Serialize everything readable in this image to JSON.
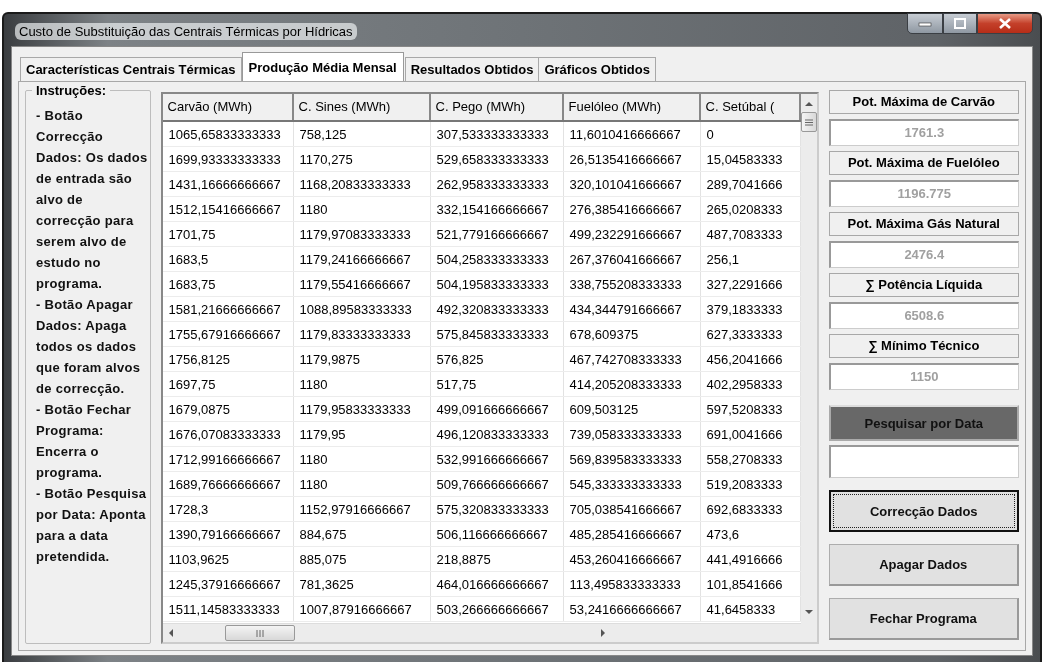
{
  "window": {
    "title": "Custo de Substituição das Centrais Térmicas por Hídricas"
  },
  "tabs": [
    {
      "label": "Características Centrais Térmicas",
      "selected": false
    },
    {
      "label": "Produção Média Mensal",
      "selected": true
    },
    {
      "label": "Resultados Obtidos",
      "selected": false
    },
    {
      "label": "Gráficos Obtidos",
      "selected": false
    }
  ],
  "instructions": {
    "title": "Instruções:",
    "items": [
      "- Botão Correcção Dados: Os dados de entrada são alvo de correcção para serem alvo de estudo no programa.",
      "- Botão Apagar Dados: Apaga todos os dados que foram alvos de correcção.",
      "- Botão Fechar Programa: Encerra o programa.",
      "- Botão Pesquisa por Data: Aponta para a data pretendida."
    ]
  },
  "table": {
    "columns": [
      "Carvão (MWh)",
      "C. Sines (MWh)",
      "C. Pego (MWh)",
      "Fuelóleo (MWh)",
      "C. Setúbal ("
    ],
    "rows": [
      [
        "1065,65833333333",
        "758,125",
        "307,533333333333",
        "11,6010416666667",
        "0"
      ],
      [
        "1699,93333333333",
        "1170,275",
        "529,658333333333",
        "26,5135416666667",
        "15,04583333"
      ],
      [
        "1431,16666666667",
        "1168,20833333333",
        "262,958333333333",
        "320,101041666667",
        "289,7041666"
      ],
      [
        "1512,15416666667",
        "1180",
        "332,154166666667",
        "276,385416666667",
        "265,0208333"
      ],
      [
        "1701,75",
        "1179,97083333333",
        "521,779166666667",
        "499,232291666667",
        "487,7083333"
      ],
      [
        "1683,5",
        "1179,24166666667",
        "504,258333333333",
        "267,376041666667",
        "256,1"
      ],
      [
        "1683,75",
        "1179,55416666667",
        "504,195833333333",
        "338,755208333333",
        "327,2291666"
      ],
      [
        "1581,21666666667",
        "1088,89583333333",
        "492,320833333333",
        "434,344791666667",
        "379,1833333"
      ],
      [
        "1755,67916666667",
        "1179,83333333333",
        "575,845833333333",
        "678,609375",
        "627,3333333"
      ],
      [
        "1756,8125",
        "1179,9875",
        "576,825",
        "467,742708333333",
        "456,2041666"
      ],
      [
        "1697,75",
        "1180",
        "517,75",
        "414,205208333333",
        "402,2958333"
      ],
      [
        "1679,0875",
        "1179,95833333333",
        "499,091666666667",
        "609,503125",
        "597,5208333"
      ],
      [
        "1676,07083333333",
        "1179,95",
        "496,120833333333",
        "739,058333333333",
        "691,0041666"
      ],
      [
        "1712,99166666667",
        "1180",
        "532,991666666667",
        "569,839583333333",
        "558,2708333"
      ],
      [
        "1689,76666666667",
        "1180",
        "509,766666666667",
        "545,333333333333",
        "519,2083333"
      ],
      [
        "1728,3",
        "1152,97916666667",
        "575,320833333333",
        "705,038541666667",
        "692,6833333"
      ],
      [
        "1390,79166666667",
        "884,675",
        "506,116666666667",
        "485,285416666667",
        "473,6"
      ],
      [
        "1103,9625",
        "885,075",
        "218,8875",
        "453,260416666667",
        "441,4916666"
      ],
      [
        "1245,37916666667",
        "781,3625",
        "464,016666666667",
        "113,495833333333",
        "101,8541666"
      ],
      [
        "1511,14583333333",
        "1007,87916666667",
        "503,266666666667",
        "53,2416666666667",
        "41,6458333"
      ]
    ]
  },
  "summary_fields": [
    {
      "label": "Pot. Máxima de Carvão",
      "value": "1761.3"
    },
    {
      "label": "Pot. Máxima de Fuelóleo",
      "value": "1196.775"
    },
    {
      "label": "Pot. Máxima Gás Natural",
      "value": "2476.4"
    },
    {
      "label": "∑ Potência Líquida",
      "value": "6508.6"
    },
    {
      "label": "∑ Mínimo Técnico",
      "value": "1150"
    }
  ],
  "search": {
    "button": "Pesquisar por Data"
  },
  "buttons": [
    {
      "label": "Correcção Dados",
      "focused": true
    },
    {
      "label": "Apagar Dados",
      "focused": false
    },
    {
      "label": "Fechar Programa",
      "focused": false
    }
  ]
}
